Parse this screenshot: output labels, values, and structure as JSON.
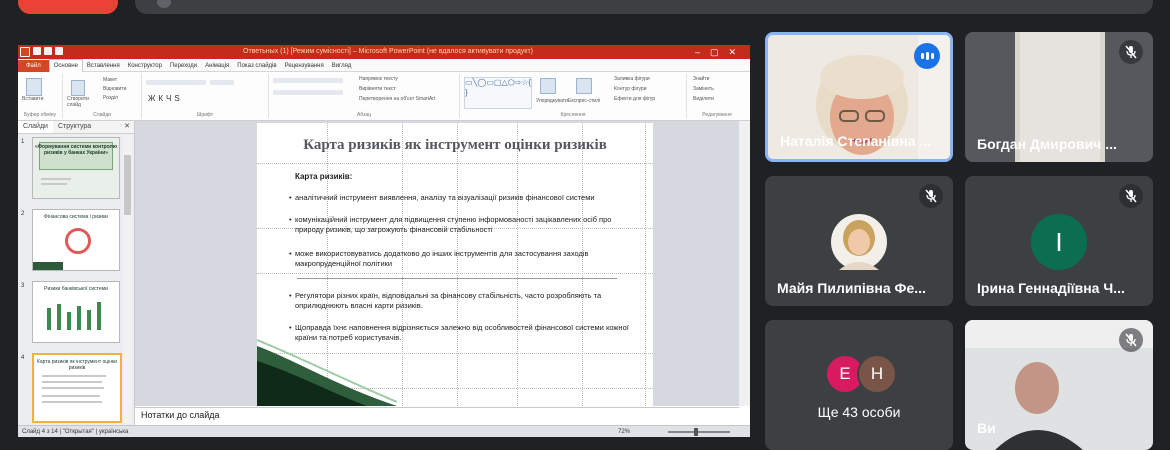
{
  "powerpoint": {
    "window_title": "Ответьных (1) [Режим сумісності] – Microsoft PowerPoint (не вдалося активувати продукт)",
    "tabs": [
      "Файл",
      "Основне",
      "Вставлення",
      "Конструктор",
      "Переходи",
      "Анімація",
      "Показ слайдів",
      "Рецензування",
      "Вигляд"
    ],
    "ribbon_groups": [
      "Буфер обміну",
      "Слайди",
      "Шрифт",
      "Абзац",
      "Креслення",
      "Редагування"
    ],
    "ribbon_items": {
      "paste": "Вставити",
      "new_slide": "Створити слайд",
      "layout": "Макет",
      "reset": "Відновити",
      "section": "Розділ",
      "text_direction": "Напрямок тексту",
      "align_text": "Вирівняти текст",
      "smartart": "Перетворення на об'єкт SmartArt",
      "arrange": "Упорядкувати",
      "quick_styles": "Експрес-стилі",
      "shape_fill": "Заливка фігури",
      "shape_outline": "Контур фігури",
      "shape_effects": "Ефекти для фігур",
      "find": "Знайти",
      "replace": "Замінить",
      "select": "Виділити"
    },
    "side_tabs": {
      "slides": "Слайди",
      "outline": "Структура"
    },
    "thumbnails": [
      {
        "num": "1",
        "title": "«Формування системи контролю ризиків у банках України»"
      },
      {
        "num": "2",
        "title": "Фінансова система і ризики"
      },
      {
        "num": "3",
        "title": "Ризики банківської системи"
      },
      {
        "num": "4",
        "title": "Карта ризиків як інструмент оцінки ризиків"
      }
    ],
    "slide": {
      "title": "Карта ризиків як інструмент оцінки ризиків",
      "heading": "Карта ризиків:",
      "bullets": [
        "аналітичний інструмент виявлення, аналізу та візуалізації ризиків фінансової системи",
        "комунікаційний інструмент для підвищення ступеню інформованості зацікавлених осіб про природу ризиків, що загрожують фінансовій стабільності",
        "може використовуватись додатково до інших інструментів для застосування заходів макропруденційної політики",
        "Регулятори різних країн, відповідальні за фінансову стабільність, часто розробляють та оприлюднюють власні карти ризиків.",
        "Щоправда їхнє наповнення відрізняється залежно від особливостей фінансової системи кожної країни та потреб користувачів."
      ]
    },
    "notes_placeholder": "Нотатки до слайда",
    "status": {
      "slide_of": "Слайд 4 з 14",
      "theme": "\"Открытая\"",
      "language": "українська",
      "zoom": "72%"
    }
  },
  "participants": [
    {
      "name": "Наталія Степанівна ...",
      "speaking": true,
      "muted": false
    },
    {
      "name": "Богдан Дмирович ...",
      "muted": true
    },
    {
      "name": "Майя Пилипівна Фе...",
      "muted": true
    },
    {
      "name": "Ірина Геннадіївна Ч...",
      "muted": true,
      "initial": "І"
    },
    {
      "name": "Ще 43 особи",
      "avatars": [
        "E",
        "Н"
      ]
    },
    {
      "name": "Ви",
      "muted": true
    }
  ],
  "colors": {
    "meet_bg": "#202124",
    "tile_bg": "#3c4043",
    "active_border": "#8ab4f8",
    "speaking": "#1a73e8",
    "ppt_red": "#c42b1c",
    "avatar_i": "#0b6f4f",
    "avatar_e": "#d81b60",
    "avatar_n": "#795548"
  }
}
